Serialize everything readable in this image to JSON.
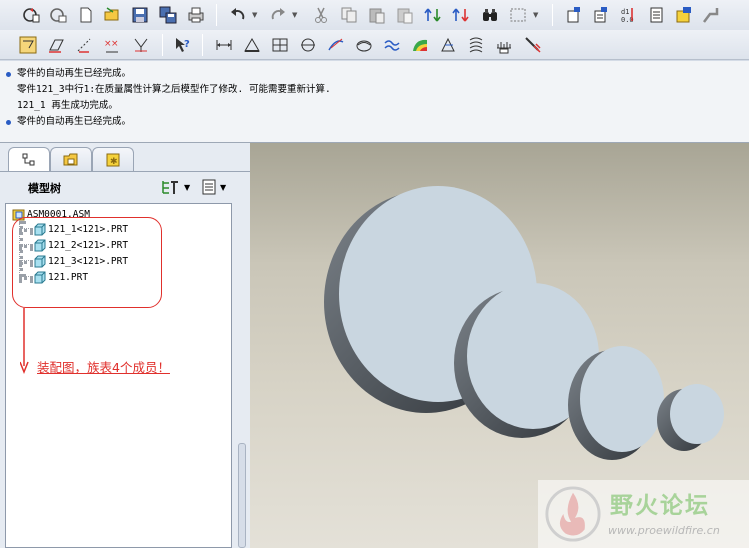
{
  "toolbar": {
    "row1_icons": [
      "regenerate-icon",
      "regenerate-manager-icon",
      "new-file-icon",
      "open-folder-icon",
      "save-icon",
      "save-copy-icon",
      "print-icon",
      "undo-icon",
      "redo-icon",
      "cut-icon",
      "copy-icon",
      "paste-icon",
      "paste-special-icon",
      "reorder-icon",
      "reorder-alt-icon",
      "find-icon",
      "select-box-icon",
      "model-relations-icon",
      "parameters-icon",
      "switch-dimensions-icon",
      "family-table-icon",
      "layer-icon",
      "program-icon"
    ],
    "row2_icons": [
      "select-filter-icon",
      "sketch-line-icon",
      "sketch-point-icon",
      "axis-display-icon",
      "csys-display-icon",
      "whats-this-icon",
      "measure-distance-icon",
      "mass-properties-icon",
      "section-analysis-icon",
      "curvature-icon",
      "offset-analysis-icon",
      "deviation-icon",
      "draft-analysis-icon",
      "shaded-curvature-icon",
      "reflection-icon",
      "slope-icon",
      "dihedral-icon",
      "annotate-icon"
    ]
  },
  "messages": [
    {
      "bullet": true,
      "text": "零件的自动再生已经完成。"
    },
    {
      "bullet": false,
      "text": "零件121_3中行1:在质量属性计算之后模型作了修改. 可能需要重新计算."
    },
    {
      "bullet": true,
      "text": "121_1 再生成功完成。"
    },
    {
      "bullet": true,
      "text": "零件的自动再生已经完成。"
    }
  ],
  "left_panel": {
    "tabs": [
      "model-tree-tab",
      "folder-browser-tab",
      "favorites-tab"
    ],
    "tree_title": "模型树",
    "settings_icon": "tree-settings-icon",
    "show_icon": "tree-show-icon",
    "tree": {
      "root": "ASM0001.ASM",
      "children": [
        "121_1<121>.PRT",
        "121_2<121>.PRT",
        "121_3<121>.PRT",
        "121.PRT"
      ]
    }
  },
  "annotation": {
    "text": "装配图，族表4个成员！",
    "color": "#e0302c"
  },
  "watermark": {
    "text": "野火论坛",
    "url": "www.proewildfire.cn"
  },
  "colors": {
    "accent": "#2a5cc4",
    "part_face": "#c9d6e0",
    "part_edge": "#4a5056",
    "watermark_green": "#a8d39a"
  }
}
